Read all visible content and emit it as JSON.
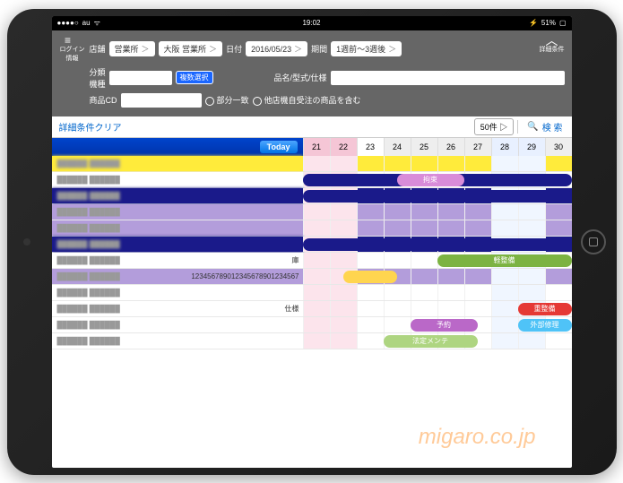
{
  "statusbar": {
    "carrier": "au",
    "time": "19:02",
    "battery": "51%"
  },
  "menu": {
    "login_info": "ログイン情報"
  },
  "filters": {
    "store_label": "店舗",
    "store_branch": "営業所",
    "store_city": "大阪 営業所",
    "date_label": "日付",
    "date_value": "2016/05/23",
    "period_label": "期間",
    "period_value": "1週前～3週後",
    "expand_label": "詳細条件",
    "class_label": "分類",
    "maker_label": "機種",
    "multi_select": "複数選択",
    "product_name_label": "品名/型式/仕様",
    "product_cd_label": "商品CD",
    "partial_match": "部分一致",
    "include_other": "他店機自受注の商品を含む"
  },
  "actions": {
    "clear": "詳細条件クリア",
    "count": "50件 ▷",
    "search": "検 索"
  },
  "grid": {
    "today": "Today",
    "days": [
      {
        "d": "21",
        "cls": "wknd"
      },
      {
        "d": "22",
        "cls": "wknd"
      },
      {
        "d": "23",
        "cls": "today"
      },
      {
        "d": "24",
        "cls": ""
      },
      {
        "d": "25",
        "cls": ""
      },
      {
        "d": "26",
        "cls": ""
      },
      {
        "d": "27",
        "cls": ""
      },
      {
        "d": "28",
        "cls": "lite"
      },
      {
        "d": "29",
        "cls": "lite"
      },
      {
        "d": "30",
        "cls": ""
      }
    ],
    "extras": {
      "code": "123456789012345678901234567",
      "spec": "仕様",
      "store": "庫"
    },
    "tags": {
      "kousoku": "拘束",
      "keisebi": "軽整備",
      "juusebi": "重整備",
      "yoyaku": "予約",
      "gaibu": "外部修理",
      "houtei": "法定メンテ"
    }
  },
  "watermark": "migaro.co.jp"
}
